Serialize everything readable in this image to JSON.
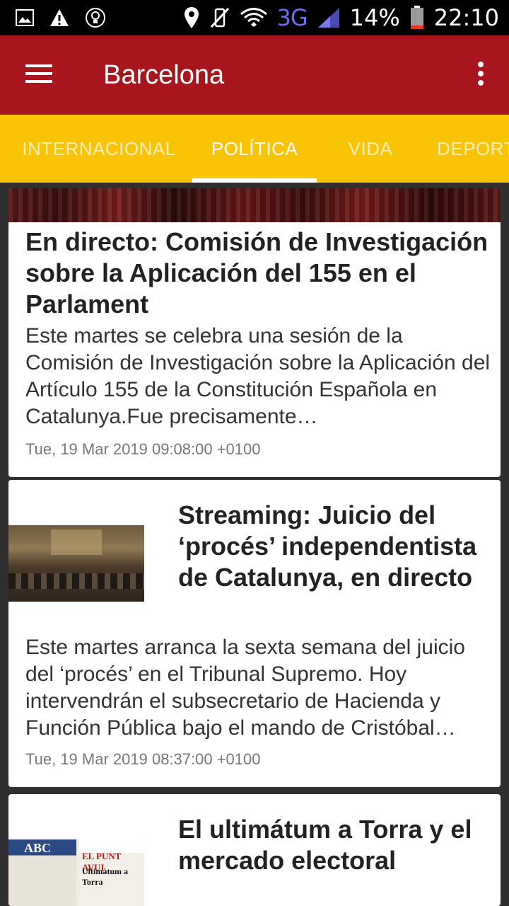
{
  "status_bar": {
    "network": "3G",
    "battery": "14%",
    "time": "22:10"
  },
  "app_bar": {
    "title": "Barcelona"
  },
  "tabs": [
    {
      "label": "INTERNACIONAL"
    },
    {
      "label": "POLÍTICA",
      "active": true
    },
    {
      "label": "VIDA"
    },
    {
      "label": "DEPORT"
    }
  ],
  "articles": [
    {
      "title": "En directo: Comisión de Investigación sobre la Aplicación del 155 en el Parlament",
      "description": "Este martes se celebra una sesión de la Comisión de Investigación sobre la Aplicación del Artículo 155 de la Constitución Española en Catalunya.Fue precisamente…",
      "date": "Tue, 19 Mar 2019 09:08:00 +0100"
    },
    {
      "title": "Streaming: Juicio del ‘procés’ independentista de Catalunya, en directo",
      "description": "Este martes arranca la sexta semana del juicio del ‘procés’ en el Tribunal Supremo. Hoy intervendrán el subsecretario de Hacienda y Función Pública bajo el mando de Cristóbal…",
      "date": "Tue, 19 Mar 2019 08:37:00 +0100"
    },
    {
      "title": "El ultimátum a Torra y el mercado electoral",
      "thumb_text": {
        "paper1": "ABC",
        "paper2": "EL PUNT AVUI",
        "paper2_headline": "Ultimàtum a Torra"
      }
    }
  ],
  "colors": {
    "app_bar": "#a8151d",
    "tab_bar": "#f9c406",
    "background": "#2f2f2f"
  }
}
